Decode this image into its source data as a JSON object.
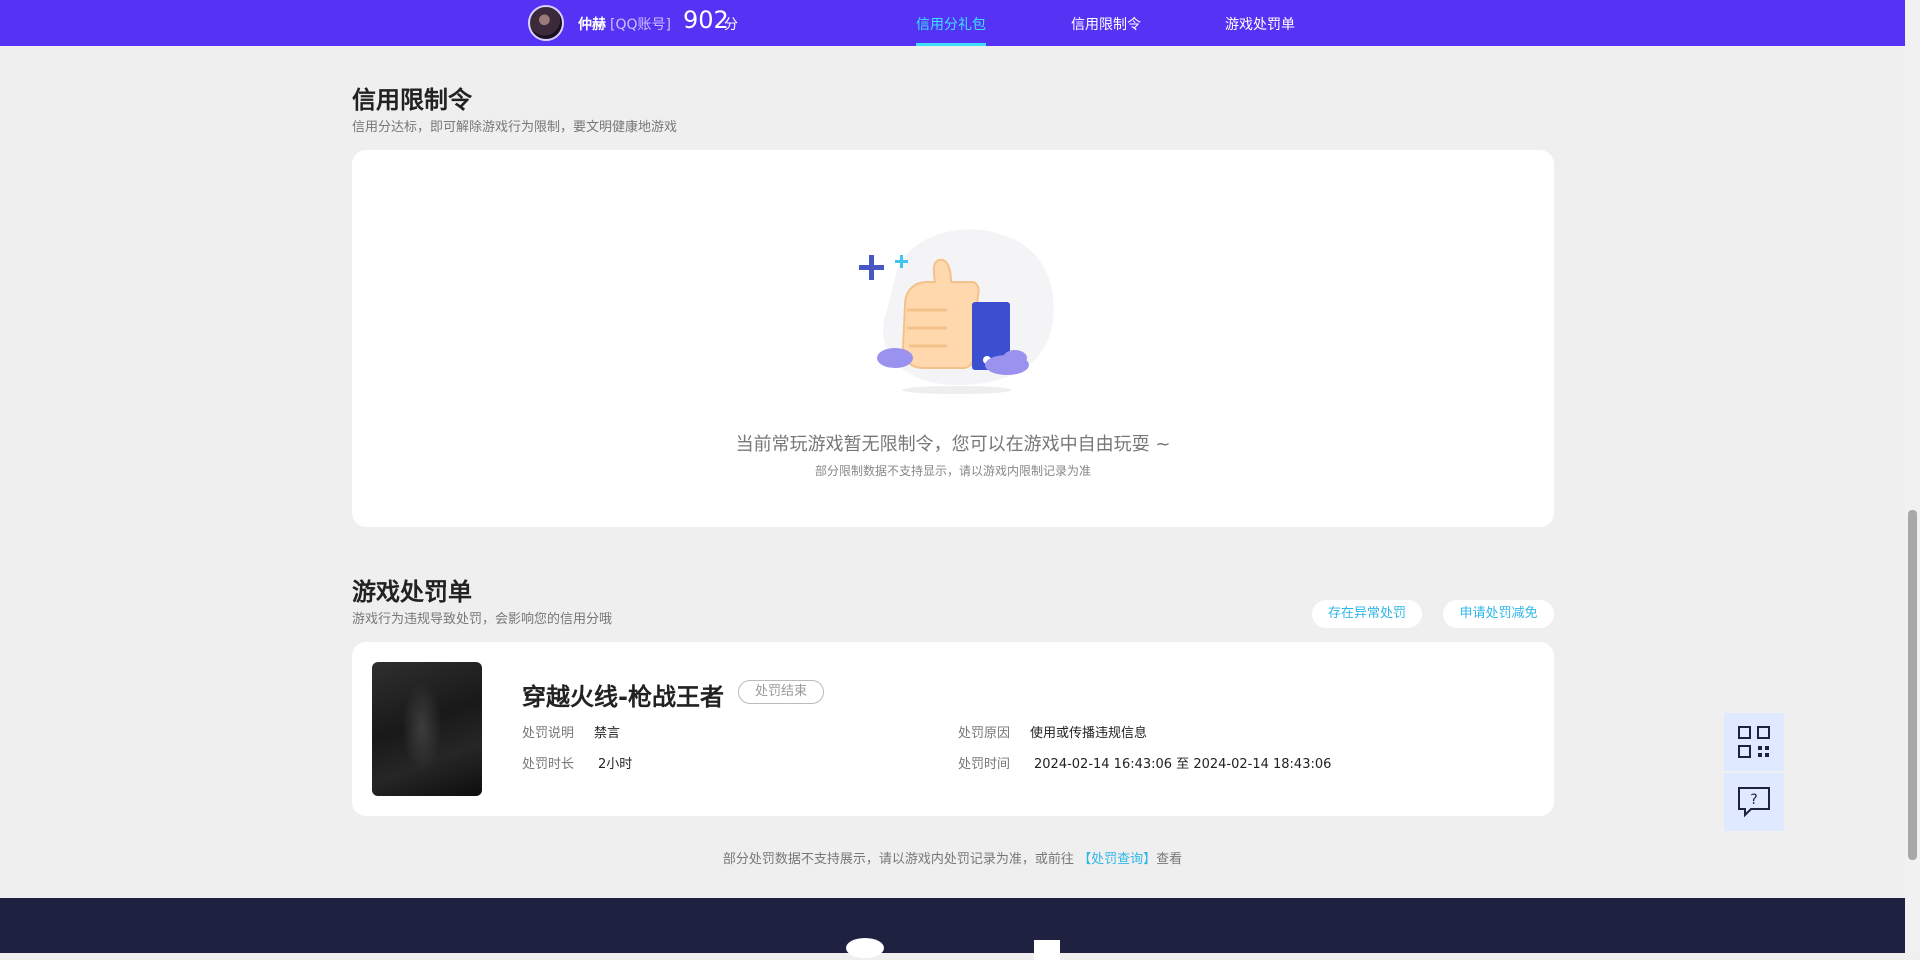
{
  "header": {
    "username": "仲赫",
    "account_type": "[QQ账号]",
    "score": "902",
    "score_unit": "分",
    "nav": [
      {
        "label": "信用分礼包",
        "active": true
      },
      {
        "label": "信用限制令",
        "active": false
      },
      {
        "label": "游戏处罚单",
        "active": false
      }
    ]
  },
  "restrictions": {
    "title": "信用限制令",
    "subtitle": "信用分达标，即可解除游戏行为限制，要文明健康地游戏",
    "empty_title": "当前常玩游戏暂无限制令，您可以在游戏中自由玩耍 ~",
    "empty_note": "部分限制数据不支持显示，请以游戏内限制记录为准"
  },
  "punishments": {
    "title": "游戏处罚单",
    "subtitle": "游戏行为违规导致处罚，会影响您的信用分哦",
    "buttons": [
      "存在异常处罚",
      "申请处罚减免"
    ],
    "record": {
      "game": "穿越火线-枪战王者",
      "status": "处罚结束",
      "desc_label": "处罚说明",
      "desc_value": "禁言",
      "duration_label": "处罚时长",
      "duration_value": "2小时",
      "reason_label": "处罚原因",
      "reason_value": "使用或传播违规信息",
      "time_label": "处罚时间",
      "time_value": "2024-02-14 16:43:06 至 2024-02-14 18:43:06"
    },
    "footer_note_prefix": "部分处罚数据不支持展示，请以游戏内处罚记录为准，或前往",
    "footer_note_link": "【处罚查询】",
    "footer_note_suffix": "查看"
  },
  "float_tools": [
    "qr-code-icon",
    "help-icon"
  ],
  "colors": {
    "header_bg": "#5533f5",
    "active_tab": "#3fe0ff",
    "link": "#2fb7e8",
    "footer_bg": "#1e2140"
  }
}
